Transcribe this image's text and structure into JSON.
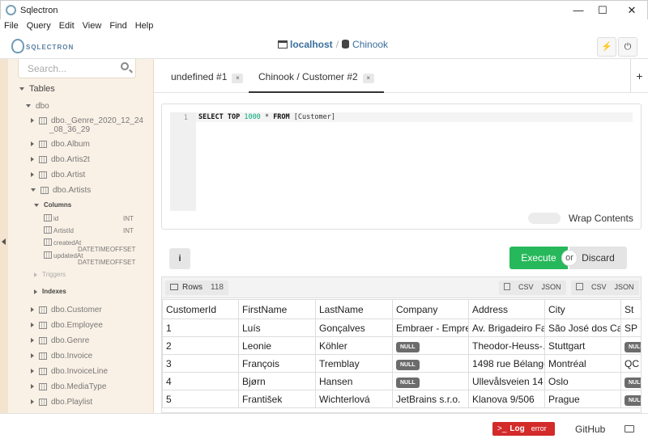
{
  "window": {
    "title": "Sqlectron",
    "minimize": "—",
    "maximize": "☐",
    "close": "✕"
  },
  "menu": [
    "File",
    "Query",
    "Edit",
    "View",
    "Find",
    "Help"
  ],
  "header": {
    "logo_text": "SQLECTRON",
    "server": "localhost",
    "separator": "/",
    "database": "Chinook",
    "plug_icon": "plug-icon",
    "power_icon": "power-icon"
  },
  "sidebar": {
    "search_placeholder": "Search...",
    "tables_label": "Tables",
    "schema": "dbo",
    "tables_top": [
      "dbo._Genre_2020_12_24",
      "_08_36_29",
      "dbo.Album",
      "dbo.Artis2t",
      "dbo.Artist",
      "dbo.Artists"
    ],
    "columns_label": "Columns",
    "columns": [
      {
        "name": "id",
        "type": "INT"
      },
      {
        "name": "ArtistId",
        "type": "INT"
      },
      {
        "name": "createdAt",
        "type": "DATETIMEOFFSET"
      },
      {
        "name": "updatedAt",
        "type": "DATETIMEOFFSET"
      }
    ],
    "triggers_label": "Triggers",
    "indexes_label": "Indexes",
    "tables_bottom": [
      "dbo.Customer",
      "dbo.Employee",
      "dbo.Genre",
      "dbo.Invoice",
      "dbo.InvoiceLine",
      "dbo.MediaType",
      "dbo.Playlist"
    ]
  },
  "tabs": [
    {
      "label": "undefined #1",
      "close": "×"
    },
    {
      "label": "Chinook / Customer #2",
      "close": "×"
    }
  ],
  "add_tab": "+",
  "editor": {
    "line_number": "1",
    "code": {
      "kw1": "SELECT",
      "kw2": "TOP",
      "num": "1000",
      "star": "*",
      "kw3": "FROM",
      "table": "[Customer]"
    },
    "wrap_label": "Wrap Contents"
  },
  "actions": {
    "info": "i",
    "execute": "Execute",
    "or": "or",
    "discard": "Discard"
  },
  "results": {
    "rows_label": "Rows",
    "rows_count": "118",
    "copy_csv": "CSV",
    "copy_json": "JSON",
    "save_csv": "CSV",
    "save_json": "JSON",
    "columns": [
      "CustomerId",
      "FirstName",
      "LastName",
      "Company",
      "Address",
      "City",
      "St"
    ],
    "null_label": "NULL",
    "rows": [
      [
        "1",
        "Luís",
        "Gonçalves",
        "Embraer - Empre…",
        "Av. Brigadeiro Fa…",
        "São José dos Ca…",
        "SP"
      ],
      [
        "2",
        "Leonie",
        "Köhler",
        null,
        "Theodor-Heuss-…",
        "Stuttgart",
        null
      ],
      [
        "3",
        "François",
        "Tremblay",
        null,
        "1498 rue Bélanger",
        "Montréal",
        "QC"
      ],
      [
        "4",
        "Bjørn",
        "Hansen",
        null,
        "Ullevålsveien 14",
        "Oslo",
        null
      ],
      [
        "5",
        "František",
        "Wichterlová",
        "JetBrains s.r.o.",
        "Klanova 9/506",
        "Prague",
        null
      ]
    ]
  },
  "footer": {
    "log_label": "Log",
    "log_status": "error",
    "github": "GitHub"
  }
}
